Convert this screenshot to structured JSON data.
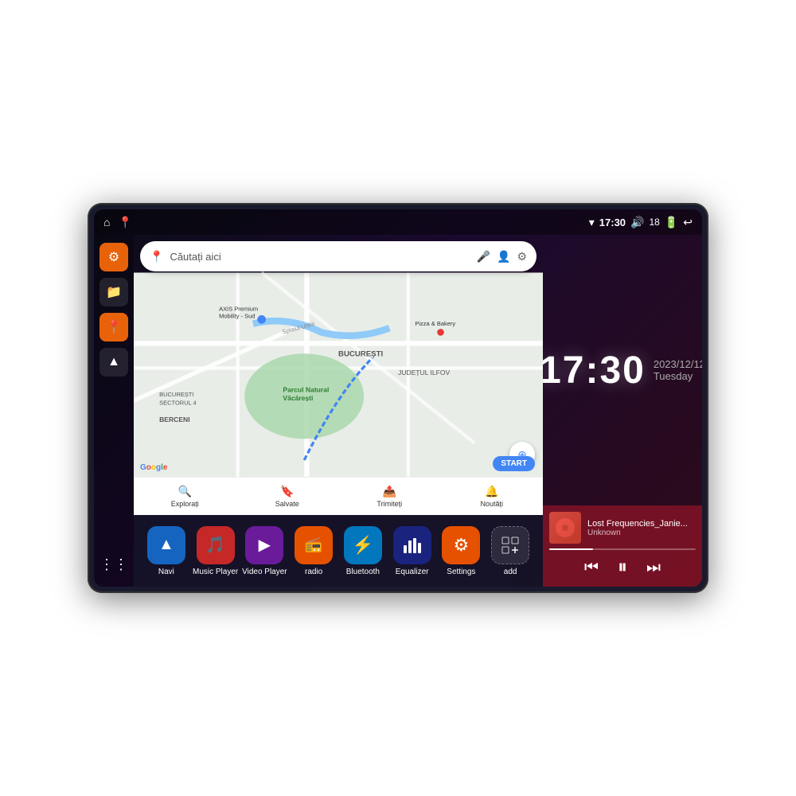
{
  "device": {
    "status_bar": {
      "wifi_icon": "▾",
      "time": "17:30",
      "volume_icon": "🔊",
      "battery_level": "18",
      "battery_icon": "🔋",
      "back_icon": "↩"
    },
    "sidebar": {
      "items": [
        {
          "id": "settings",
          "icon": "⚙",
          "label": "Settings"
        },
        {
          "id": "files",
          "icon": "📁",
          "label": "Files"
        },
        {
          "id": "maps",
          "icon": "📍",
          "label": "Maps"
        },
        {
          "id": "navigation",
          "icon": "▲",
          "label": "Navigation"
        }
      ],
      "grid_icon": "⋮⋮"
    },
    "map": {
      "search_placeholder": "Căutați aici",
      "location_pin_icon": "📍",
      "mic_icon": "🎤",
      "account_icon": "👤",
      "settings_icon": "⚙",
      "places": [
        "AXIS Premium Mobility - Sud",
        "Parcul Natural Văcărești",
        "Pizza & Bakery",
        "BUCUREȘTI SECTORUL 4",
        "BUCUREȘTI",
        "JUDEȚUL ILFOV",
        "BERCENI"
      ],
      "tabs": [
        {
          "id": "explore",
          "icon": "🔍",
          "label": "Explorați"
        },
        {
          "id": "saved",
          "icon": "🔖",
          "label": "Salvate"
        },
        {
          "id": "send",
          "icon": "📤",
          "label": "Trimiteți"
        },
        {
          "id": "updates",
          "icon": "🔔",
          "label": "Noutăți"
        }
      ]
    },
    "clock": {
      "time": "17:30",
      "date": "2023/12/12",
      "weekday": "Tuesday"
    },
    "music": {
      "title": "Lost Frequencies_Janie...",
      "artist": "Unknown",
      "prev_icon": "⏮",
      "play_icon": "⏸",
      "next_icon": "⏭",
      "progress_percent": 30
    },
    "apps": [
      {
        "id": "navi",
        "label": "Navi",
        "icon": "▲",
        "color": "blue"
      },
      {
        "id": "music-player",
        "label": "Music Player",
        "icon": "🎵",
        "color": "red"
      },
      {
        "id": "video-player",
        "label": "Video Player",
        "icon": "▶",
        "color": "purple"
      },
      {
        "id": "radio",
        "label": "radio",
        "icon": "📻",
        "color": "orange"
      },
      {
        "id": "bluetooth",
        "label": "Bluetooth",
        "icon": "⚡",
        "color": "blue2"
      },
      {
        "id": "equalizer",
        "label": "Equalizer",
        "icon": "🎚",
        "color": "darkblue"
      },
      {
        "id": "settings",
        "label": "Settings",
        "icon": "⚙",
        "color": "orange2"
      },
      {
        "id": "add",
        "label": "add",
        "icon": "+",
        "color": "gray"
      }
    ]
  }
}
